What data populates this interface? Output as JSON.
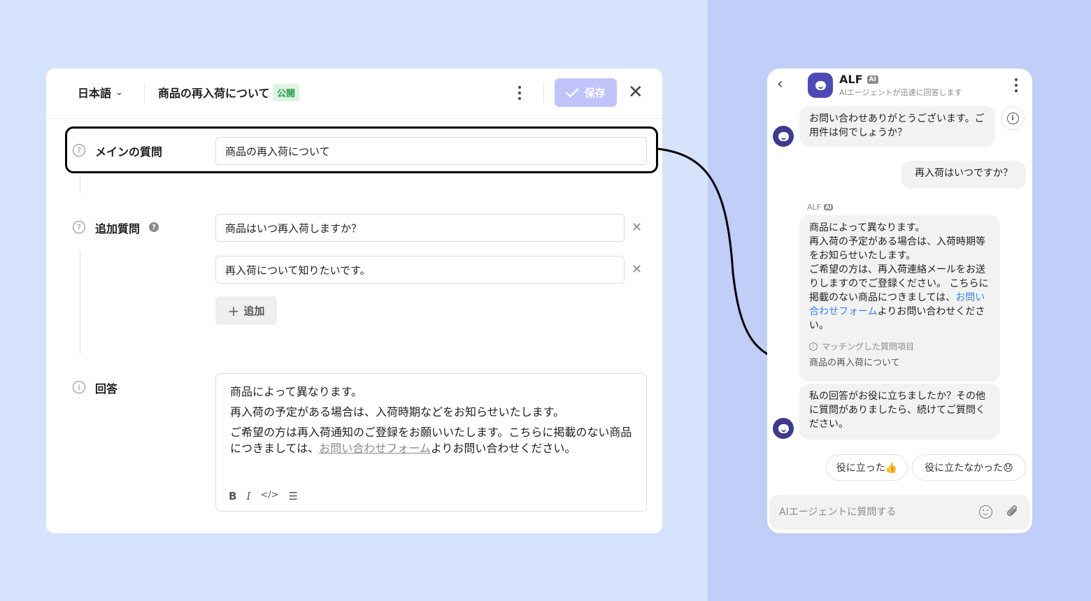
{
  "editor": {
    "language": "日本語",
    "title": "商品の再入荷について",
    "status_badge": "公開",
    "save_label": "保存",
    "main_question": {
      "label": "メインの質問",
      "value": "商品の再入荷について"
    },
    "additional_questions": {
      "label": "追加質問",
      "items": [
        "商品はいつ再入荷しますか？",
        "再入荷について知りたいです。"
      ],
      "add_label": "追加"
    },
    "answer": {
      "label": "回答",
      "line1": "商品によって異なります。",
      "line2": "再入荷の予定がある場合は、入荷時期などをお知らせいたします。",
      "line3_a": "ご希望の方は再入荷通知のご登録をお願いいたします。こちらに掲載のない商品につきましては、",
      "line3_link": "お問い合わせフォーム",
      "line3_b": "よりお問い合わせください。"
    }
  },
  "chat": {
    "bot_name": "ALF",
    "ai_tag": "AI",
    "subtitle": "AIエージェントが迅速に回答します",
    "greeting": "お問い合わせありがとうございます。ご用件は何でしょうか？",
    "user_message": "再入荷はいつですか？",
    "sender_label": "ALF",
    "answer_part1": "商品によって異なります。",
    "answer_part2": "再入荷の予定がある場合は、入荷時期等をお知らせいたします。",
    "answer_part3": "ご希望の方は、再入荷連絡メールをお送りしますのでご登録ください。 こちらに掲載のない商品につきましては、",
    "answer_link": "お問い合わせフォーム",
    "answer_part4": "よりお問い合わせください。",
    "matched_label": "マッチングした質問項目",
    "matched_value": "商品の再入荷について",
    "followup": "私の回答がお役に立ちましたか？その他に質問がありましたら、続けてご質問ください。",
    "helpful": "役に立った👍",
    "not_helpful": "役に立たなかった😞",
    "input_placeholder": "AIエージェントに質問する"
  },
  "colors": {
    "accent_save": "#c1c3fb",
    "badge_green": "#22a046",
    "link_blue": "#3b84e8",
    "bot_avatar": "#3e3b8e"
  }
}
